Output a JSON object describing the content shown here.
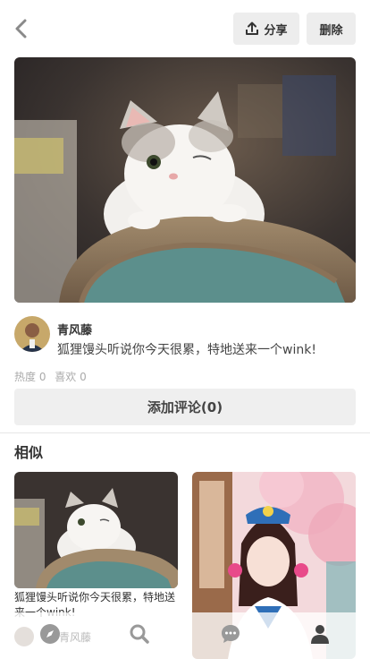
{
  "header": {
    "share_label": "分享",
    "delete_label": "删除"
  },
  "post": {
    "username": "青风藤",
    "description": "狐狸馒头听说你今天很累，特地送来一个wink!",
    "hotness": "热度 0",
    "likes": "喜欢 0",
    "comment_button": "添加评论(0)"
  },
  "similar": {
    "title": "相似",
    "items": [
      {
        "caption": "狐狸馒头听说你今天很累，特地送来一个wink!",
        "author": "青风藤"
      },
      {
        "caption": ""
      }
    ]
  },
  "tabbar": {
    "icons": [
      "compass-icon",
      "search-icon",
      "chat-icon",
      "user-icon"
    ]
  },
  "colors": {
    "button_bg": "#ededed",
    "divider": "#e6e6e6",
    "icon_gray": "#999999"
  }
}
